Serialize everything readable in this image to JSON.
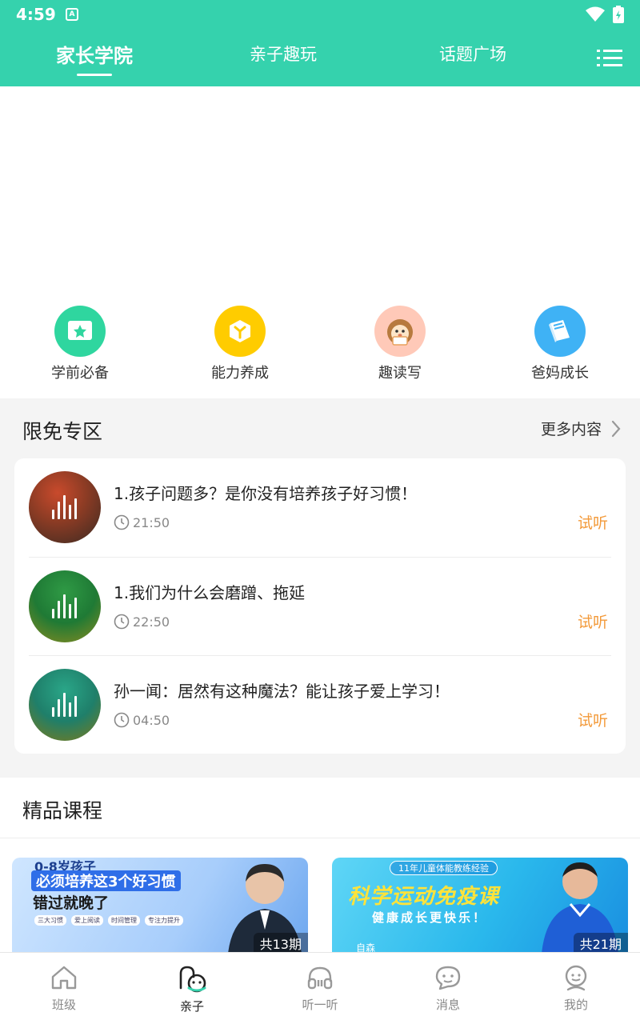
{
  "status_bar": {
    "time": "4:59",
    "notification_icon": "A"
  },
  "top_tabs": [
    {
      "label": "家长学院",
      "active": true
    },
    {
      "label": "亲子趣玩",
      "active": false
    },
    {
      "label": "话题广场",
      "active": false
    }
  ],
  "categories": [
    {
      "label": "学前必备",
      "color": "#2fd69f",
      "icon": "star-card-icon"
    },
    {
      "label": "能力养成",
      "color": "#ffcc00",
      "icon": "cube-icon"
    },
    {
      "label": "趣读写",
      "color": "#ffc9b8",
      "icon": "hedgehog-icon"
    },
    {
      "label": "爸妈成长",
      "color": "#3fb2f5",
      "icon": "book-icon"
    }
  ],
  "free_section": {
    "title": "限免专区",
    "more": "更多内容",
    "try_label": "试听",
    "items": [
      {
        "title": "1.孩子问题多？是你没有培养孩子好习惯！",
        "duration": "21:50"
      },
      {
        "title": "1.我们为什么会磨蹭、拖延",
        "duration": "22:50"
      },
      {
        "title": "孙一闻：居然有这种魔法？能让孩子爱上学习！",
        "duration": "04:50"
      }
    ]
  },
  "premium_section": {
    "title": "精品课程",
    "courses": [
      {
        "line1": "0-8岁孩子",
        "line2": "必须培养这3个好习惯",
        "line3": "错过就晚了",
        "chips": [
          "三大习惯",
          "爱上阅读",
          "时间管理",
          "专注力提升"
        ],
        "count": "共13期"
      },
      {
        "badge": "11年儿童体能教练经验",
        "line1": "科学运动免疫课",
        "line2": "健康成长更快乐！",
        "name": "自森",
        "count": "共21期"
      }
    ]
  },
  "bottom_nav": [
    {
      "label": "班级",
      "icon": "home-icon",
      "active": false
    },
    {
      "label": "亲子",
      "icon": "parent-child-icon",
      "active": true
    },
    {
      "label": "听一听",
      "icon": "headphones-icon",
      "active": false
    },
    {
      "label": "消息",
      "icon": "message-icon",
      "active": false
    },
    {
      "label": "我的",
      "icon": "profile-icon",
      "active": false
    }
  ],
  "colors": {
    "brand": "#35d2ad",
    "accent_orange": "#f39a3a"
  }
}
